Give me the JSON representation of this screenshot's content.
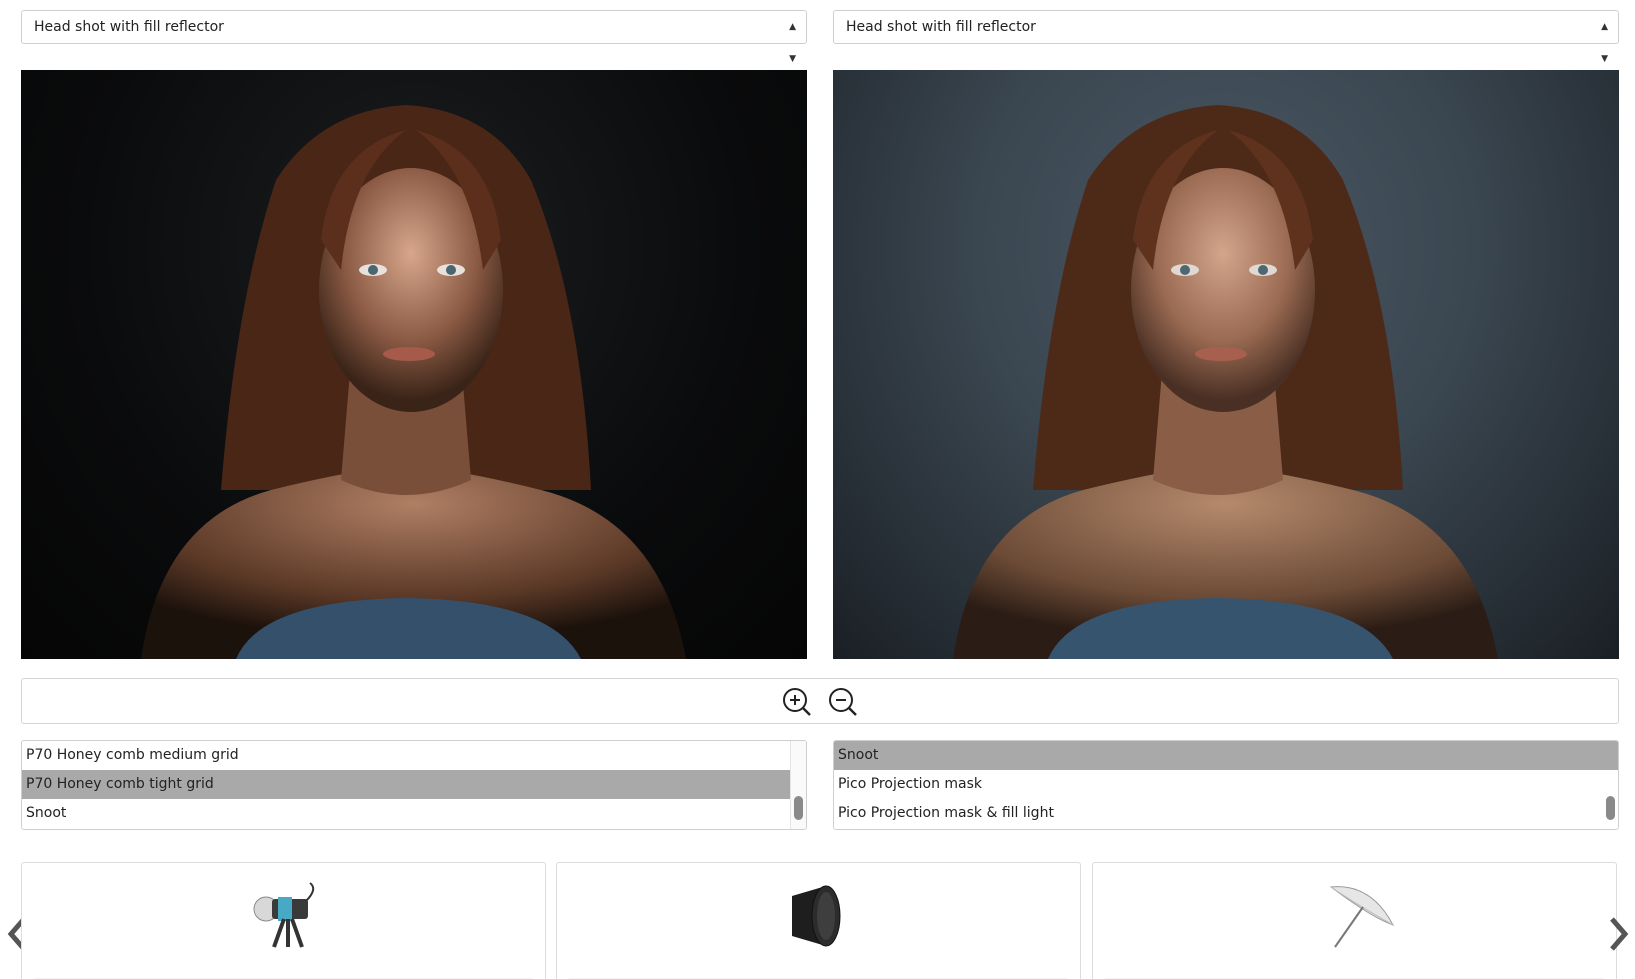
{
  "selectors": {
    "left": {
      "value": "Head shot with fill reflector"
    },
    "right": {
      "value": "Head shot with fill reflector"
    }
  },
  "zoom": {
    "zoom_in_icon": "zoom-in-icon",
    "zoom_out_icon": "zoom-out-icon"
  },
  "lists": {
    "left": {
      "options": [
        "P70 Honey comb medium grid",
        "P70 Honey comb tight grid",
        "Snoot"
      ],
      "selected_index": 1
    },
    "right": {
      "options": [
        "Snoot",
        "Pico Projection mask",
        "Pico Projection mask & fill light"
      ],
      "selected_index": 0
    }
  },
  "carousel": {
    "items": [
      {
        "icon": "studio-flash-head-icon"
      },
      {
        "icon": "reflector-dish-icon"
      },
      {
        "icon": "umbrella-icon"
      }
    ],
    "prev_icon": "chevron-left-icon",
    "next_icon": "chevron-right-icon"
  },
  "colors": {
    "selected_option": "#a9a9a9",
    "left_background": "#0a0b0c",
    "right_background": "#3a4650"
  }
}
